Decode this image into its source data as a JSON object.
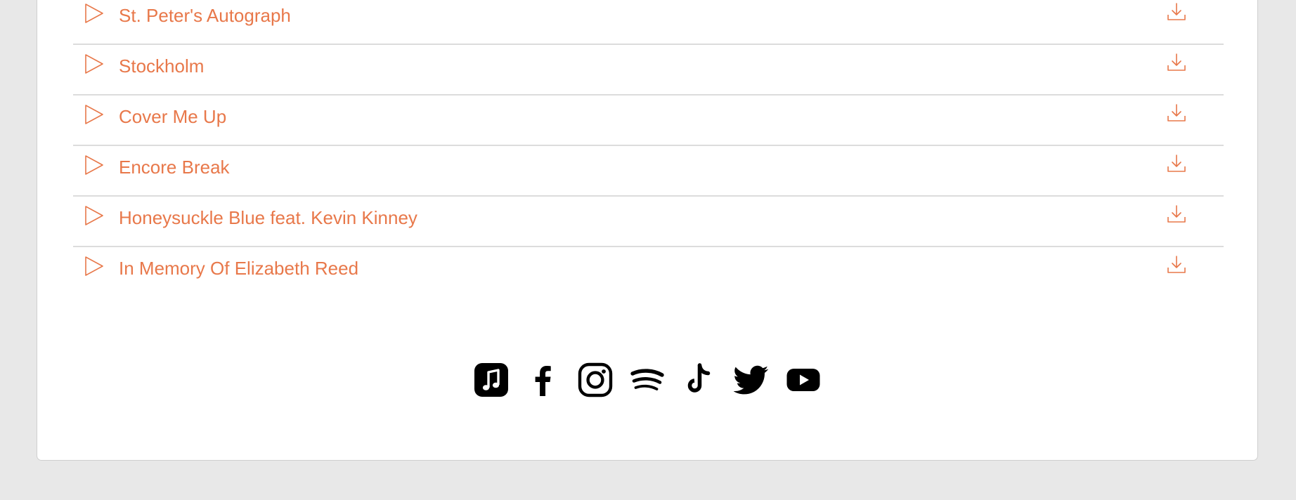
{
  "colors": {
    "accent": "#e8784a",
    "page_background": "#e8e8e8",
    "card_background": "#ffffff",
    "divider": "#dcdcdc",
    "social_icon": "#000000"
  },
  "tracks": [
    {
      "title": "St. Peter's Autograph"
    },
    {
      "title": "Stockholm"
    },
    {
      "title": "Cover Me Up"
    },
    {
      "title": "Encore Break"
    },
    {
      "title": "Honeysuckle Blue feat. Kevin Kinney"
    },
    {
      "title": "In Memory Of Elizabeth Reed"
    }
  ],
  "track_icons": {
    "play": "play-triangle-outline",
    "download": "download-tray-arrow"
  },
  "social_links": [
    {
      "icon": "apple-music-icon"
    },
    {
      "icon": "facebook-icon"
    },
    {
      "icon": "instagram-icon"
    },
    {
      "icon": "spotify-icon"
    },
    {
      "icon": "tiktok-icon"
    },
    {
      "icon": "twitter-icon"
    },
    {
      "icon": "youtube-icon"
    }
  ]
}
